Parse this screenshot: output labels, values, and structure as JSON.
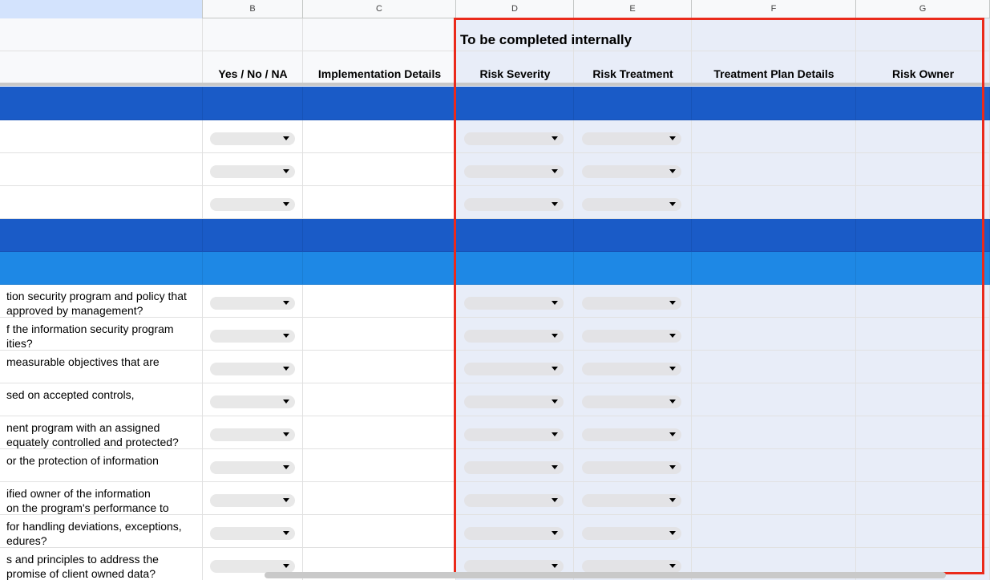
{
  "columns": [
    {
      "letter": "",
      "selected": true
    },
    {
      "letter": "B"
    },
    {
      "letter": "C"
    },
    {
      "letter": "D"
    },
    {
      "letter": "E"
    },
    {
      "letter": "F"
    },
    {
      "letter": "G"
    }
  ],
  "banner": "To be completed internally",
  "headers": {
    "b": "Yes / No / NA",
    "c": "Implementation Details",
    "d": "Risk Severity",
    "e": "Risk Treatment",
    "f": "Treatment Plan Details",
    "g": "Risk Owner"
  },
  "colors": {
    "section_dark": "#1a5bc7",
    "section_light": "#1e88e5",
    "internal_bg": "#e8edf8",
    "highlight_border": "#ea2a1b"
  },
  "questions": [
    {
      "line1": "tion security program and policy that",
      "line2": "approved by management?"
    },
    {
      "line1": "f the information security program",
      "line2": "ities?"
    },
    {
      "line1": "measurable objectives that are",
      "line2": ""
    },
    {
      "line1": "sed on accepted controls,",
      "line2": ""
    },
    {
      "line1": "nent program with an assigned",
      "line2": "equately controlled and protected?"
    },
    {
      "line1": "or the protection of information",
      "line2": ""
    },
    {
      "line1": "ified owner of the information",
      "line2": "on the program's performance to"
    },
    {
      "line1": "for handling deviations, exceptions,",
      "line2": "edures?"
    },
    {
      "line1": "s and principles to address the",
      "line2": "promise of client owned data?"
    }
  ]
}
